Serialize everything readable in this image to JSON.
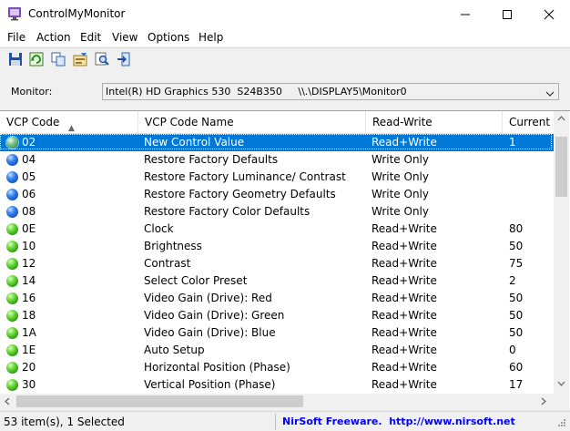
{
  "window": {
    "title": "ControlMyMonitor"
  },
  "menu": [
    "File",
    "Action",
    "Edit",
    "View",
    "Options",
    "Help"
  ],
  "toolbar": [
    {
      "icon": "save-icon"
    },
    {
      "icon": "refresh-icon"
    },
    {
      "icon": "copy-icon"
    },
    {
      "icon": "properties-icon"
    },
    {
      "icon": "find-icon"
    },
    {
      "icon": "exit-icon"
    }
  ],
  "monitor": {
    "label": "Monitor:",
    "value": "Intel(R) HD Graphics 530  S24B350     \\\\.\\DISPLAY5\\Monitor0"
  },
  "columns": [
    "VCP Code",
    "VCP Code Name",
    "Read-Write",
    "Current V"
  ],
  "rows": [
    {
      "code": "02",
      "name": "New Control Value",
      "rw": "Read+Write",
      "value": "1",
      "status": "selected"
    },
    {
      "code": "04",
      "name": "Restore Factory Defaults",
      "rw": "Write Only",
      "value": "",
      "status": "blue"
    },
    {
      "code": "05",
      "name": "Restore Factory Luminance/ Contrast",
      "rw": "Write Only",
      "value": "",
      "status": "blue"
    },
    {
      "code": "06",
      "name": "Restore Factory Geometry Defaults",
      "rw": "Write Only",
      "value": "",
      "status": "blue"
    },
    {
      "code": "08",
      "name": "Restore Factory Color Defaults",
      "rw": "Write Only",
      "value": "",
      "status": "blue"
    },
    {
      "code": "0E",
      "name": "Clock",
      "rw": "Read+Write",
      "value": "80",
      "status": "green"
    },
    {
      "code": "10",
      "name": "Brightness",
      "rw": "Read+Write",
      "value": "50",
      "status": "green"
    },
    {
      "code": "12",
      "name": "Contrast",
      "rw": "Read+Write",
      "value": "75",
      "status": "green"
    },
    {
      "code": "14",
      "name": "Select Color Preset",
      "rw": "Read+Write",
      "value": "2",
      "status": "green"
    },
    {
      "code": "16",
      "name": "Video Gain (Drive): Red",
      "rw": "Read+Write",
      "value": "50",
      "status": "green"
    },
    {
      "code": "18",
      "name": "Video Gain (Drive): Green",
      "rw": "Read+Write",
      "value": "50",
      "status": "green"
    },
    {
      "code": "1A",
      "name": "Video Gain (Drive): Blue",
      "rw": "Read+Write",
      "value": "50",
      "status": "green"
    },
    {
      "code": "1E",
      "name": "Auto Setup",
      "rw": "Read+Write",
      "value": "0",
      "status": "green"
    },
    {
      "code": "20",
      "name": "Horizontal Position (Phase)",
      "rw": "Read+Write",
      "value": "60",
      "status": "green"
    },
    {
      "code": "30",
      "name": "Vertical Position (Phase)",
      "rw": "Read+Write",
      "value": "17",
      "status": "green"
    }
  ],
  "status": {
    "count": "53 item(s), 1 Selected",
    "link": "NirSoft Freeware.  http://www.nirsoft.net"
  },
  "colors": {
    "selection": "#0078d7",
    "link": "#0000ff"
  }
}
